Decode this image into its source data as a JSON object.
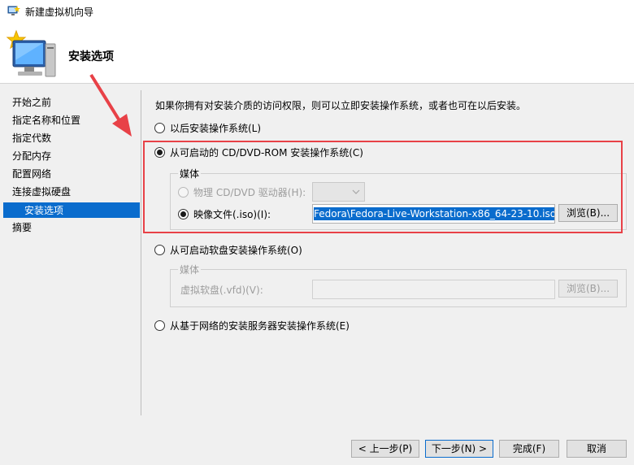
{
  "window": {
    "title": "新建虚拟机向导"
  },
  "header": {
    "title": "安装选项",
    "icon": "computer-monitor-icon"
  },
  "sidebar": {
    "items": [
      {
        "label": "开始之前"
      },
      {
        "label": "指定名称和位置"
      },
      {
        "label": "指定代数"
      },
      {
        "label": "分配内存"
      },
      {
        "label": "配置网络"
      },
      {
        "label": "连接虚拟硬盘"
      },
      {
        "label": "安装选项"
      },
      {
        "label": "摘要"
      }
    ],
    "active_index": 6
  },
  "main": {
    "intro": "如果你拥有对安装介质的访问权限，则可以立即安装操作系统，或者也可在以后安装。",
    "option_later": "以后安装操作系统(L)",
    "option_cd": "从可启动的 CD/DVD-ROM 安装操作系统(C)",
    "cd_media_label": "媒体",
    "cd_physical_label": "物理 CD/DVD 驱动器(H):",
    "cd_image_label": "映像文件(.iso)(I):",
    "cd_image_value": "Fedora\\Fedora-Live-Workstation-x86_64-23-10.iso",
    "cd_browse": "浏览(B)...",
    "option_floppy": "从可启动软盘安装操作系统(O)",
    "floppy_media_label": "媒体",
    "floppy_label": "虚拟软盘(.vfd)(V):",
    "floppy_value": "",
    "floppy_browse": "浏览(B)...",
    "option_network": "从基于网络的安装服务器安装操作系统(E)"
  },
  "footer": {
    "prev": "< 上一步(P)",
    "next": "下一步(N) >",
    "finish": "完成(F)",
    "cancel": "取消"
  },
  "colors": {
    "highlight": "#e84147",
    "selection": "#0a6ccd"
  }
}
